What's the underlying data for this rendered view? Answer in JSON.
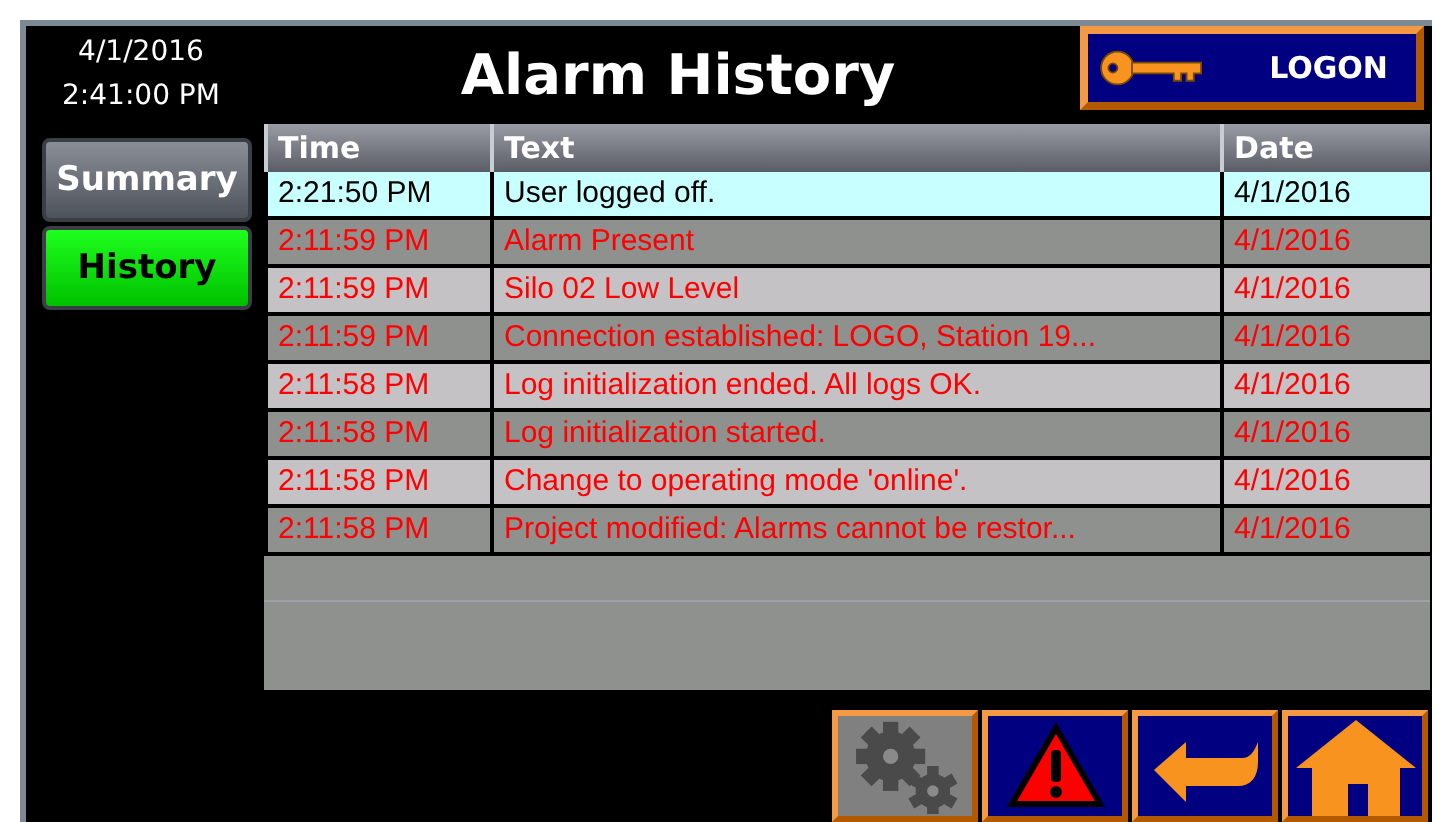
{
  "clock": {
    "date": "4/1/2016",
    "time": "2:41:00 PM"
  },
  "title": "Alarm History",
  "logon_button": {
    "label": "LOGON"
  },
  "nav": [
    {
      "label": "Summary",
      "selected": false
    },
    {
      "label": "History",
      "selected": true
    }
  ],
  "table": {
    "columns": [
      "Time",
      "Text",
      "Date"
    ],
    "rows": [
      {
        "kind": "info",
        "selected": true,
        "time": "2:21:50 PM",
        "text": "User logged off.",
        "date": "4/1/2016"
      },
      {
        "kind": "alarm",
        "selected": false,
        "time": "2:11:59 PM",
        "text": "Alarm Present",
        "date": "4/1/2016"
      },
      {
        "kind": "alarm",
        "selected": false,
        "time": "2:11:59 PM",
        "text": "Silo 02 Low Level",
        "date": "4/1/2016"
      },
      {
        "kind": "alarm",
        "selected": false,
        "time": "2:11:59 PM",
        "text": "Connection established: LOGO, Station 19...",
        "date": "4/1/2016"
      },
      {
        "kind": "alarm",
        "selected": false,
        "time": "2:11:58 PM",
        "text": "Log initialization ended. All logs OK.",
        "date": "4/1/2016"
      },
      {
        "kind": "alarm",
        "selected": false,
        "time": "2:11:58 PM",
        "text": "Log initialization started.",
        "date": "4/1/2016"
      },
      {
        "kind": "alarm",
        "selected": false,
        "time": "2:11:58 PM",
        "text": "Change to operating mode 'online'.",
        "date": "4/1/2016"
      },
      {
        "kind": "alarm",
        "selected": false,
        "time": "2:11:58 PM",
        "text": "Project modified: Alarms cannot be restor...",
        "date": "4/1/2016"
      }
    ]
  },
  "toolbar": [
    {
      "kind": "settings",
      "disabled": true
    },
    {
      "kind": "alarm",
      "disabled": false
    },
    {
      "kind": "back",
      "disabled": false
    },
    {
      "kind": "home",
      "disabled": false
    }
  ]
}
